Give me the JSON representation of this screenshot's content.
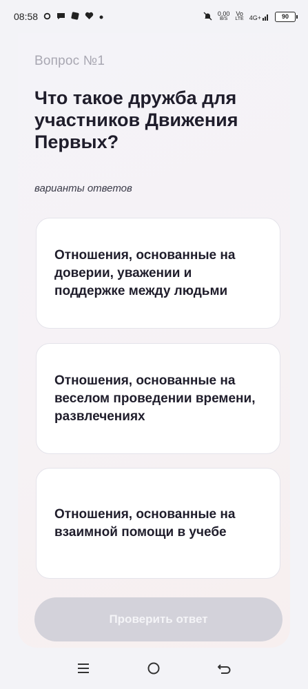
{
  "status_bar": {
    "time": "08:58",
    "net_speed_value": "0,00",
    "net_speed_unit": "B/S",
    "volte_top": "Vo",
    "volte_bottom": "LTE",
    "network_type": "4G+",
    "battery_level": "90"
  },
  "quiz": {
    "question_number": "Вопрос №1",
    "question_text": "Что такое дружба для участников Движения Первых?",
    "answers_label": "варианты ответов",
    "answers": [
      {
        "text": "Отношения, основанные на доверии, уважении и поддержке между людьми"
      },
      {
        "text": "Отношения, основанные на веселом проведении времени, развлечениях"
      },
      {
        "text": "Отношения, основанные на взаимной помощи в учебе"
      }
    ],
    "check_button_label": "Проверить ответ"
  },
  "nav_bar": {
    "icons": [
      "menu-icon",
      "home-icon",
      "back-icon"
    ]
  }
}
